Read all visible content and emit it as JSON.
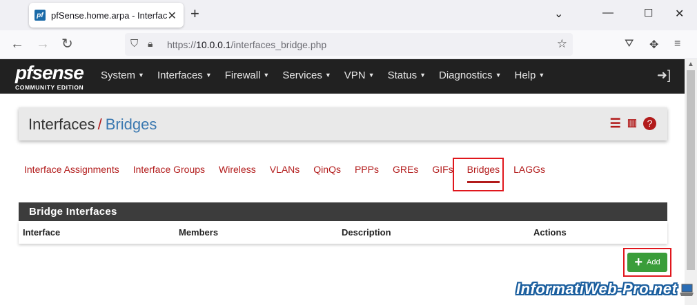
{
  "browser": {
    "tab_title": "pfSense.home.arpa - Interfaces: Bridges",
    "url_prefix": "https://",
    "url_host": "10.0.0.1",
    "url_path": "/interfaces_bridge.php"
  },
  "navbar": {
    "logo_main": "pfsense",
    "logo_sub": "COMMUNITY EDITION",
    "menu": [
      "System",
      "Interfaces",
      "Firewall",
      "Services",
      "VPN",
      "Status",
      "Diagnostics",
      "Help"
    ]
  },
  "breadcrumb": {
    "parent": "Interfaces",
    "separator": "/",
    "current": "Bridges"
  },
  "subtabs": [
    "Interface Assignments",
    "Interface Groups",
    "Wireless",
    "VLANs",
    "QinQs",
    "PPPs",
    "GREs",
    "GIFs",
    "Bridges",
    "LAGGs"
  ],
  "active_subtab": "Bridges",
  "panel": {
    "title": "Bridge Interfaces",
    "columns": [
      "Interface",
      "Members",
      "Description",
      "Actions"
    ]
  },
  "add_button": {
    "label": "Add"
  },
  "watermark": "InformatiWeb-Pro.net",
  "colors": {
    "accent_red": "#b21b1b",
    "link_blue": "#3a78b0",
    "nav_dark": "#212121",
    "add_green": "#3a9d3a",
    "highlight_red": "#e0161c"
  }
}
